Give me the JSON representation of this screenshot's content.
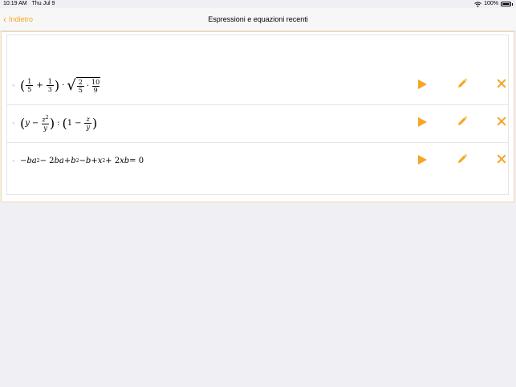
{
  "status": {
    "time": "10:19 AM",
    "date": "Thu Jul 9",
    "battery": "100%"
  },
  "nav": {
    "back_label": "Indietro",
    "title": "Espressioni e equazioni recenti"
  },
  "rows": [
    {
      "formula_html": "<span style=\"font-style:normal;font-size:16px\">(</span><span style=\"display:inline-flex;flex-direction:column;align-items:center;font-style:normal;font-size:8px;margin:0 1px\"><span>1</span><span style=\"border-top:1px solid #000;padding:0 2px\">5</span></span><span style=\"font-style:normal;margin:0 3px\">+</span><span style=\"display:inline-flex;flex-direction:column;align-items:center;font-style:normal;font-size:8px;margin:0 1px\"><span>1</span><span style=\"border-top:1px solid #000;padding:0 2px\">3</span></span><span style=\"font-style:normal;font-size:16px\">)</span><span style=\"font-style:normal;margin:0 3px\">·</span><span style=\"font-style:normal;font-size:18px\">√</span><span style=\"border-top:1px solid #000;display:inline-flex;align-items:center;padding-top:1px\"><span style=\"display:inline-flex;flex-direction:column;align-items:center;font-style:normal;font-size:8px;margin:0 1px\"><span>2</span><span style=\"border-top:1px solid #000;padding:0 2px\">5</span></span><span style=\"font-style:normal;margin:0 2px\">·</span><span style=\"display:inline-flex;flex-direction:column;align-items:center;font-style:normal;font-size:8px;margin:0 1px\"><span>10</span><span style=\"border-top:1px solid #000;padding:0 2px\">9</span></span></span>"
    },
    {
      "formula_html": "<span style=\"font-style:normal;font-size:16px\">(</span><span>y</span><span style=\"font-style:normal;margin:0 3px\">−</span><span style=\"display:inline-flex;flex-direction:column;align-items:center;font-size:8px;margin:0 1px\"><span>z<sup style=\"font-size:6px;font-style:normal\">2</sup></span><span style=\"border-top:1px solid #000;padding:0 2px\">y</span></span><span style=\"font-style:normal;font-size:16px\">)</span><span style=\"font-style:normal;margin:0 3px\">:</span><span style=\"font-style:normal;font-size:16px\">(</span><span style=\"font-style:normal\">1</span><span style=\"font-style:normal;margin:0 3px\">−</span><span style=\"display:inline-flex;flex-direction:column;align-items:center;font-size:8px;margin:0 1px\"><span>z</span><span style=\"border-top:1px solid #000;padding:0 2px\">y</span></span><span style=\"font-style:normal;font-size:16px\">)</span>"
    },
    {
      "formula_html": "−<i>ba</i><sup style=\"font-size:6px;font-style:normal\">2</sup> <span style=\"font-style:normal\">− 2</span><i>ba</i> <span style=\"font-style:normal\">+</span> <i>b</i><sup style=\"font-size:6px;font-style:normal\">2</sup> <span style=\"font-style:normal\">−</span> <i>b</i> <span style=\"font-style:normal\">+</span> <i>x</i><sup style=\"font-size:6px;font-style:normal\">2</sup> <span style=\"font-style:normal\">+ 2</span><i>xb</i> <span style=\"font-style:normal\">= 0</span>"
    }
  ],
  "icons": {
    "back": "chevron-left-icon",
    "play": "play-icon",
    "edit": "pencil-icon",
    "delete": "close-icon",
    "wifi": "wifi-icon",
    "battery": "battery-icon"
  },
  "colors": {
    "accent": "#f5a623",
    "background": "#f0eff4",
    "panel_border": "#f3d9a8"
  }
}
